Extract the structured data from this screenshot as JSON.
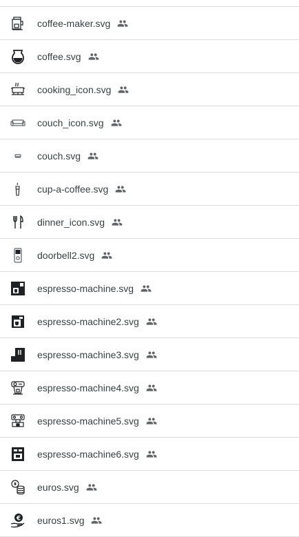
{
  "files": [
    {
      "name": "",
      "icon": "blank-icon",
      "shared": false
    },
    {
      "name": "coffee-maker.svg",
      "icon": "coffee-maker-icon",
      "shared": true
    },
    {
      "name": "coffee.svg",
      "icon": "coffee-pot-icon",
      "shared": true
    },
    {
      "name": "cooking_icon.svg",
      "icon": "cooking-pot-icon",
      "shared": true
    },
    {
      "name": "couch_icon.svg",
      "icon": "couch-outline-icon",
      "shared": true
    },
    {
      "name": "couch.svg",
      "icon": "couch-small-icon",
      "shared": true
    },
    {
      "name": "cup-a-coffee.svg",
      "icon": "coffee-cup-icon",
      "shared": true
    },
    {
      "name": "dinner_icon.svg",
      "icon": "fork-knife-icon",
      "shared": true
    },
    {
      "name": "doorbell2.svg",
      "icon": "doorbell-icon",
      "shared": true
    },
    {
      "name": "espresso-machine.svg",
      "icon": "espresso-machine-icon",
      "shared": true
    },
    {
      "name": "espresso-machine2.svg",
      "icon": "espresso-machine-2-icon",
      "shared": true
    },
    {
      "name": "espresso-machine3.svg",
      "icon": "espresso-machine-3-icon",
      "shared": true
    },
    {
      "name": "espresso-machine4.svg",
      "icon": "espresso-machine-4-icon",
      "shared": true
    },
    {
      "name": "espresso-machine5.svg",
      "icon": "espresso-machine-5-icon",
      "shared": true
    },
    {
      "name": "espresso-machine6.svg",
      "icon": "espresso-machine-6-icon",
      "shared": true
    },
    {
      "name": "euros.svg",
      "icon": "coin-stack-icon",
      "shared": true
    },
    {
      "name": "euros1.svg",
      "icon": "euro-hand-icon",
      "shared": true
    }
  ],
  "colors": {
    "divider": "#dadce0",
    "text": "#3c4043",
    "shared_icon": "#5f6368",
    "thumb_icon": "#202124"
  }
}
